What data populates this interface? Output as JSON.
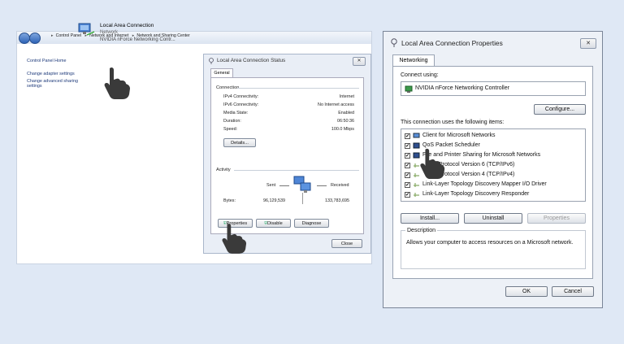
{
  "explorer": {
    "breadcrumbs": [
      "Control Panel",
      "Network and Internet",
      "Network and Sharing Center"
    ],
    "left_links": [
      "Control Panel Home",
      "Change adapter settings",
      "Change advanced sharing settings"
    ],
    "connection": {
      "title": "Local Area Connection",
      "subtitle": "Network",
      "device": "NVIDIA nForce Networking Contr..."
    }
  },
  "status_dialog": {
    "title": "Local Area Connection Status",
    "tab": "General",
    "connection_group": "Connection",
    "rows": [
      {
        "label": "IPv4 Connectivity:",
        "value": "Internet"
      },
      {
        "label": "IPv6 Connectivity:",
        "value": "No Internet access"
      },
      {
        "label": "Media State:",
        "value": "Enabled"
      },
      {
        "label": "Duration:",
        "value": "06:50:36"
      },
      {
        "label": "Speed:",
        "value": "100.0 Mbps"
      }
    ],
    "details_label": "Details...",
    "activity_group": "Activity",
    "sent_label": "Sent",
    "received_label": "Received",
    "bytes_label": "Bytes:",
    "bytes_sent": "96,129,539",
    "bytes_received": "133,783,695",
    "buttons": {
      "properties": "Properties",
      "disable": "Disable",
      "diagnose": "Diagnose",
      "close": "Close"
    },
    "close_x": "✕"
  },
  "properties_dialog": {
    "title": "Local Area Connection Properties",
    "tab": "Networking",
    "connect_using_label": "Connect using:",
    "adapter": "NVIDIA nForce Networking Controller",
    "configure_label": "Configure...",
    "items_label": "This connection uses the following items:",
    "items": [
      {
        "label": "Client for Microsoft Networks",
        "checked": true
      },
      {
        "label": "QoS Packet Scheduler",
        "checked": true
      },
      {
        "label": "File and Printer Sharing for Microsoft Networks",
        "checked": true
      },
      {
        "label": "Protocol Version 6 (TCP/IPv6)",
        "checked": true
      },
      {
        "label": "Protocol Version 4 (TCP/IPv4)",
        "checked": true
      },
      {
        "label": "Link-Layer Topology Discovery Mapper I/O Driver",
        "checked": true
      },
      {
        "label": "Link-Layer Topology Discovery Responder",
        "checked": true
      }
    ],
    "install_label": "Install...",
    "uninstall_label": "Uninstall",
    "properties_label": "Properties",
    "description_label": "Description",
    "description_text": "Allows your computer to access resources on a Microsoft network.",
    "ok_label": "OK",
    "cancel_label": "Cancel",
    "close_x": "✕",
    "check_mark": "✔"
  },
  "colors": {
    "background": "#dfe8f5",
    "dialog": "#edf1f7",
    "link": "#1e3a7a"
  }
}
